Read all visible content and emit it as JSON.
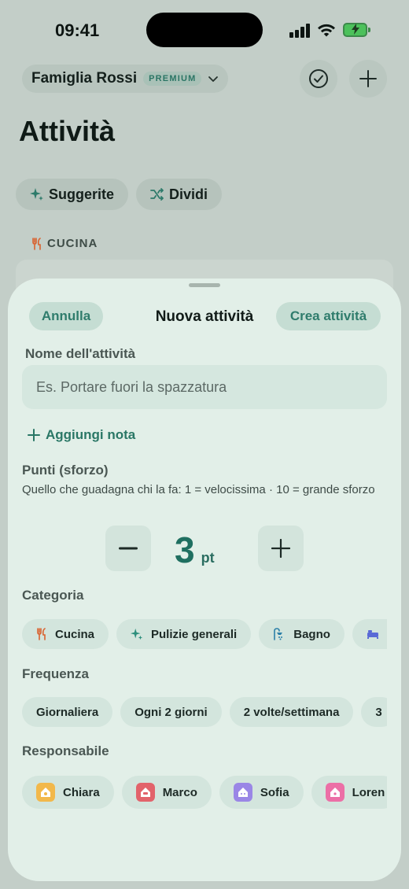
{
  "status_bar": {
    "time": "09:41"
  },
  "header": {
    "family_name": "Famiglia Rossi",
    "badge": "PREMIUM",
    "check_icon": "check-circle-icon",
    "add_icon": "plus-icon"
  },
  "page": {
    "title": "Attività",
    "chips": [
      {
        "icon": "sparkles-icon",
        "label": "Suggerite"
      },
      {
        "icon": "shuffle-icon",
        "label": "Dividi"
      }
    ],
    "section": {
      "icon": "fork-knife-icon",
      "label": "CUCINA"
    }
  },
  "sheet": {
    "cancel_label": "Annulla",
    "title": "Nuova attività",
    "create_label": "Crea attività",
    "name_label": "Nome dell'attività",
    "name_placeholder": "Es. Portare fuori la spazzatura",
    "name_value": "",
    "add_note_label": "Aggiungi nota",
    "points_label": "Punti (sforzo)",
    "points_hint": "Quello che guadagna chi la fa: 1 = velocissima · 10 = grande sforzo",
    "points_value": "3",
    "points_unit": "pt",
    "category_label": "Categoria",
    "categories": [
      {
        "icon": "fork-knife-icon",
        "label": "Cucina"
      },
      {
        "icon": "sparkles-icon",
        "label": "Pulizie generali"
      },
      {
        "icon": "shower-icon",
        "label": "Bagno"
      },
      {
        "icon": "bed-icon",
        "label": ""
      }
    ],
    "frequency_label": "Frequenza",
    "frequencies": [
      "Giornaliera",
      "Ogni 2 giorni",
      "2 volte/settimana",
      "3"
    ],
    "assignee_label": "Responsabile",
    "assignees": [
      {
        "name": "Chiara",
        "color": "#f2b84b"
      },
      {
        "name": "Marco",
        "color": "#e2636b"
      },
      {
        "name": "Sofia",
        "color": "#9a86e6"
      },
      {
        "name": "Loren",
        "color": "#ec6fa6"
      }
    ]
  },
  "colors": {
    "accent": "#2a7766",
    "sheet_bg": "#e2efe8",
    "chip_bg": "#d3e5dd"
  }
}
